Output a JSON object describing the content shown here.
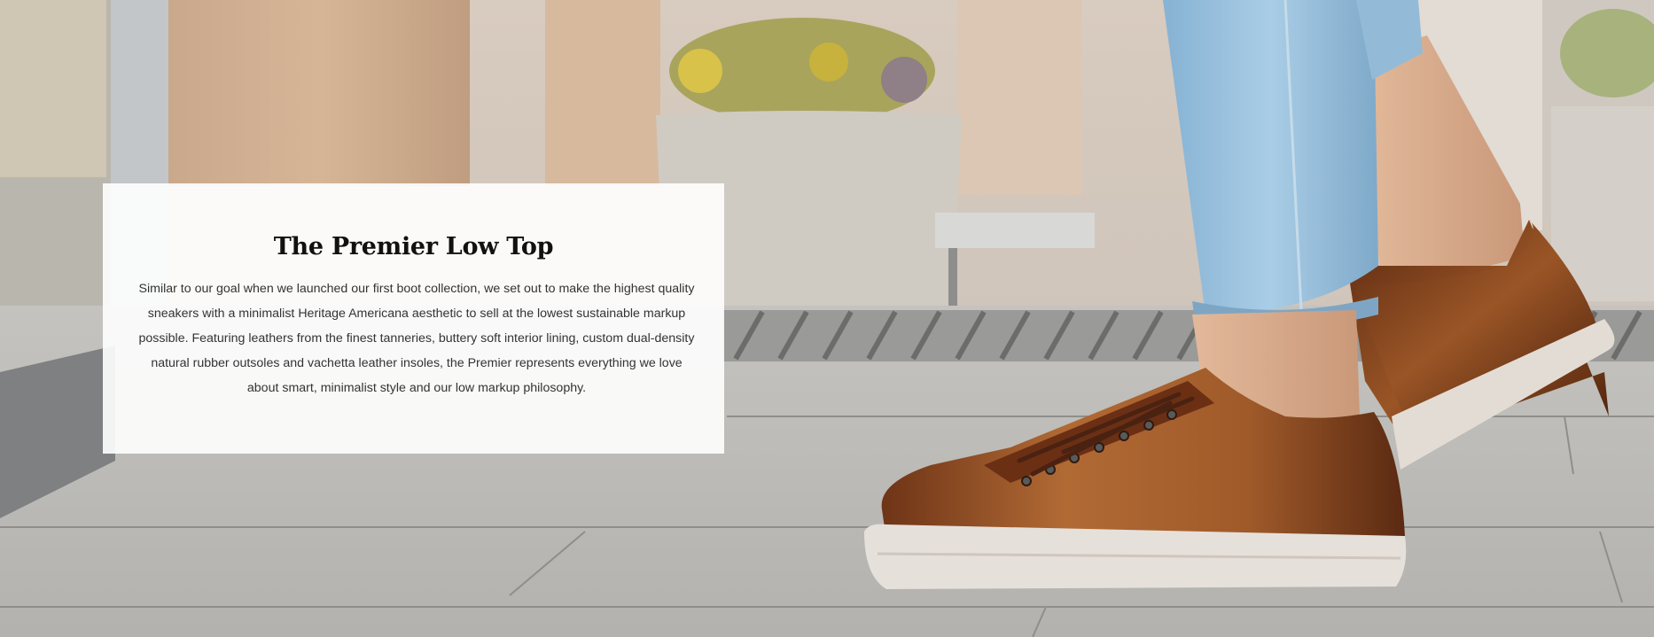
{
  "hero": {
    "image_alt": "Person walking wearing brown leather low-top sneakers with white rubber soles and light-wash jeans on a stone sidewalk",
    "colors": {
      "leather": "#8a4a22",
      "sole": "#e6e0da",
      "denim": "#9cc3de",
      "pavement": "#b7b6b2"
    }
  },
  "panel": {
    "title": "The Premier Low Top",
    "description": "Similar to our goal when we launched our first boot collection, we set out to make the highest quality sneakers with a minimalist Heritage Americana aesthetic to sell at the lowest sustainable markup possible. Featuring leathers from the finest tanneries, buttery soft interior lining, custom dual-density natural rubber outsoles and vachetta leather insoles, the Premier represents everything we love about smart, minimalist style and our low markup philosophy."
  }
}
